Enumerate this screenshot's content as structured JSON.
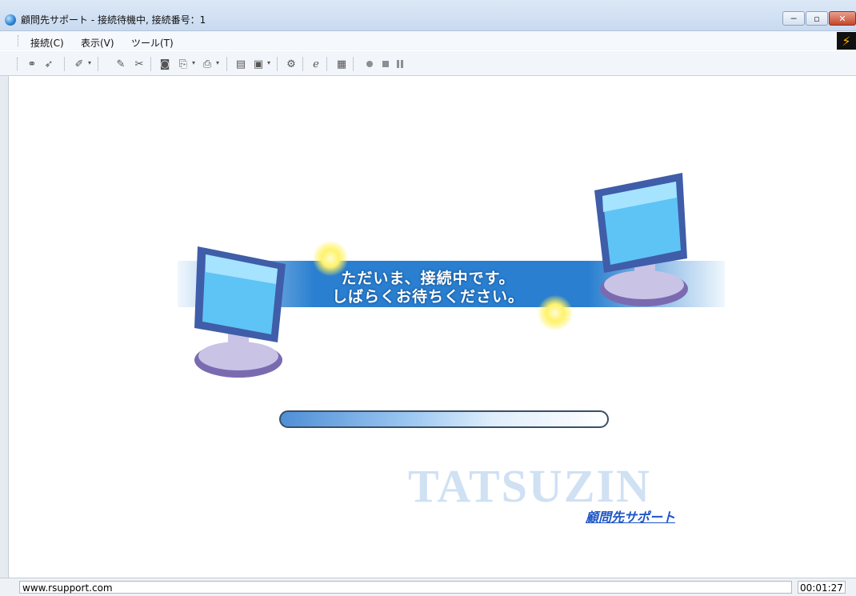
{
  "window": {
    "title": "顧問先サポート - 接続待機中, 接続番号：1",
    "minimize_glyph": "─",
    "maximize_glyph": "▫",
    "close_glyph": "✕"
  },
  "menu": [
    {
      "label": "接続(C)"
    },
    {
      "label": "表示(V)"
    },
    {
      "label": "ツール(T)"
    }
  ],
  "toolbar_icons": [
    "connect-icon",
    "pointer-icon",
    "laser-pointer-icon",
    "pen-icon",
    "eraser-icon",
    "screenshot-icon",
    "send-file-icon",
    "print-icon",
    "clipboard-icon",
    "screen-capture-icon",
    "settings-icon",
    "browser-icon",
    "screen-view-icon",
    "record-icon",
    "stop-icon",
    "pause-icon"
  ],
  "banner": {
    "line1": "ただいま、接続中です。",
    "line2": "しばらくお待ちください。"
  },
  "progress": {
    "value": 0.6
  },
  "brand": {
    "name": "TATSUZIN",
    "sub": "顧問先サポート"
  },
  "status": {
    "url": "www.rsupport.com",
    "time": "00:01:27"
  },
  "colors": {
    "banner_blue": "#2a7fd0",
    "brand_sub": "#1f56c6"
  }
}
